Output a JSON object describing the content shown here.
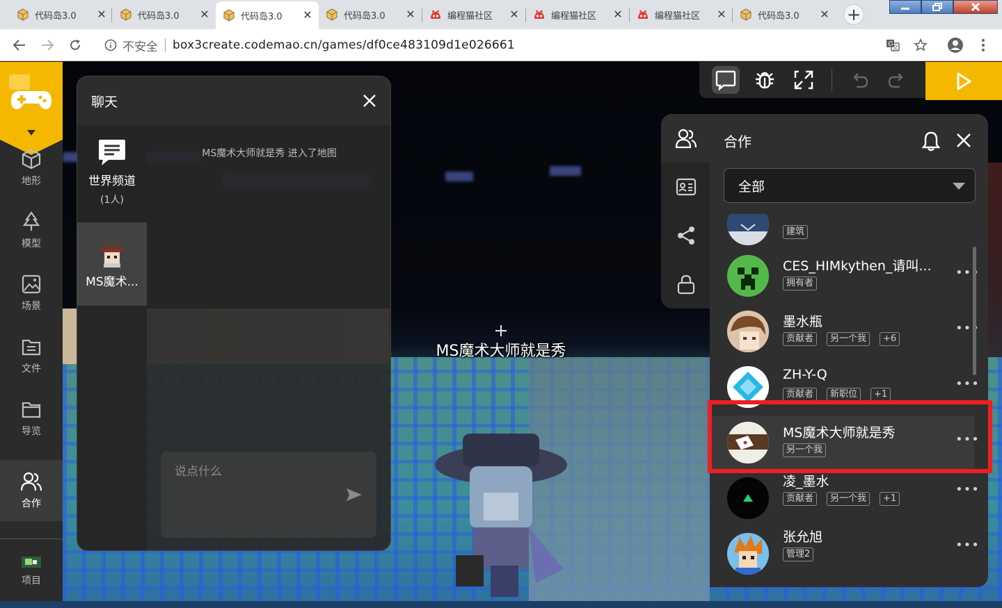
{
  "browser": {
    "tabs": [
      {
        "title": "代码岛3.0",
        "icon": "box-icon",
        "active": false
      },
      {
        "title": "代码岛3.0",
        "icon": "box-icon",
        "active": false
      },
      {
        "title": "代码岛3.0",
        "icon": "box-icon",
        "active": true
      },
      {
        "title": "代码岛3.0",
        "icon": "box-icon",
        "active": false
      },
      {
        "title": "编程猫社区",
        "icon": "cat-icon",
        "active": false
      },
      {
        "title": "编程猫社区",
        "icon": "cat-icon",
        "active": false
      },
      {
        "title": "编程猫社区",
        "icon": "cat-icon",
        "active": false
      },
      {
        "title": "代码岛3.0",
        "icon": "box-icon",
        "active": false
      }
    ],
    "insecure_label": "不安全",
    "url": "box3create.codemao.cn/games/df0ce483109d1e026661"
  },
  "leftbar": {
    "items": [
      {
        "label": "地形",
        "icon": "cube-icon"
      },
      {
        "label": "模型",
        "icon": "tree-icon"
      },
      {
        "label": "场景",
        "icon": "image-icon"
      },
      {
        "label": "文件",
        "icon": "folder-list-icon"
      },
      {
        "label": "导览",
        "icon": "folder-icon"
      },
      {
        "label": "合作",
        "icon": "users-icon"
      },
      {
        "label": "项目",
        "icon": "project-thumb-icon"
      }
    ]
  },
  "chat": {
    "title": "聊天",
    "world_channel": "世界频道",
    "world_count": "(1人)",
    "user_channel": "MS魔术...",
    "message": "MS魔术大师就是秀 进入了地图",
    "input_placeholder": "说点什么"
  },
  "scene": {
    "player_name": "MS魔术大师就是秀"
  },
  "collab": {
    "title": "合作",
    "filter_value": "全部",
    "members": [
      {
        "name": "",
        "badges": [
          "建筑"
        ]
      },
      {
        "name": "CES_HIMkythen_请叫...",
        "badges": [
          "拥有者"
        ]
      },
      {
        "name": "墨水瓶",
        "badges": [
          "贡献者",
          "另一个我",
          "+6"
        ]
      },
      {
        "name": "ZH-Y-Q",
        "badges": [
          "贡献者",
          "新职位",
          "+1"
        ]
      },
      {
        "name": "MS魔术大师就是秀",
        "badges": [
          "另一个我"
        ]
      },
      {
        "name": "凌_墨水",
        "badges": [
          "贡献者",
          "另一个我",
          "+1"
        ]
      },
      {
        "name": "张允旭",
        "badges": [
          "管理2"
        ]
      }
    ],
    "more_label": "•••"
  },
  "colors": {
    "accent": "#f5b800",
    "highlight": "#f01f1f",
    "panel": "#2f2f2f"
  }
}
